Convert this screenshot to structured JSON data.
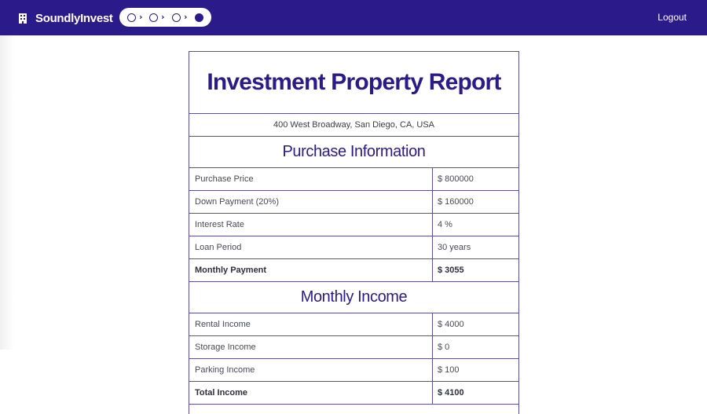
{
  "app": {
    "brand_name": "SoundlyInvest",
    "brand_icon": "building-icon",
    "logout_label": "Logout",
    "accent_color": "#2b1a8a",
    "stepper": {
      "total_steps": 4,
      "current_step": 4
    }
  },
  "report": {
    "title": "Investment Property Report",
    "address": "400 West Broadway, San Diego, CA, USA",
    "purchase": {
      "heading": "Purchase Information",
      "rows": [
        {
          "label": "Purchase Price",
          "value": "$ 800000"
        },
        {
          "label": "Down Payment (20%)",
          "value": "$ 160000"
        },
        {
          "label": "Interest Rate",
          "value": "4 %"
        },
        {
          "label": "Loan Period",
          "value": "30 years"
        },
        {
          "label": "Monthly Payment",
          "value": "$ 3055"
        }
      ]
    },
    "income": {
      "heading": "Monthly Income",
      "rows": [
        {
          "label": "Rental Income",
          "value": "$ 4000"
        },
        {
          "label": "Storage Income",
          "value": "$ 0"
        },
        {
          "label": "Parking Income",
          "value": "$ 100"
        },
        {
          "label": "Total Income",
          "value": "$ 4100"
        }
      ]
    }
  }
}
